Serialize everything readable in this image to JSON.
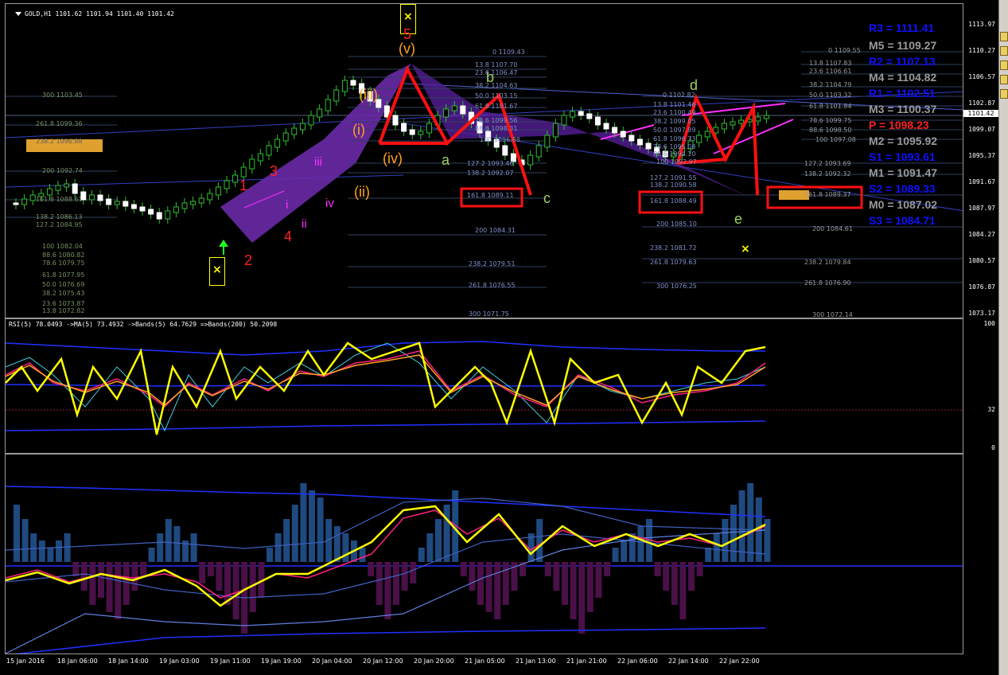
{
  "window": {
    "title": "GOLD,H1  1101.62 1101.94 1101.40 1101.42"
  },
  "price_axis": {
    "labels": [
      "1113.97",
      "1110.27",
      "1106.57",
      "1102.87",
      "1099.07",
      "1095.37",
      "1091.67",
      "1087.97",
      "1084.27",
      "1080.57",
      "1076.87",
      "1073.17"
    ],
    "current": "1101.42"
  },
  "rsi_pane": {
    "title": "RSI(5) 78.0493  ->MA(5) 73.4932  ->Bands(5) 64.7629  =>Bands(200) 50.2098",
    "axis": [
      "100",
      "32",
      "0"
    ]
  },
  "time_axis": {
    "labels": [
      "15 Jan 2016",
      "18 Jan 06:00",
      "18 Jan 14:00",
      "19 Jan 03:00",
      "19 Jan 11:00",
      "19 Jan 19:00",
      "20 Jan 04:00",
      "20 Jan 12:00",
      "20 Jan 20:00",
      "21 Jan 05:00",
      "21 Jan 13:00",
      "21 Jan 21:00",
      "22 Jan 06:00",
      "22 Jan 14:00",
      "22 Jan 22:00"
    ]
  },
  "pivots": [
    {
      "label": "R3 = 1111.41",
      "color": "#1010ff"
    },
    {
      "label": "M5 = 1109.27",
      "color": "#9a9a9a"
    },
    {
      "label": "R2 = 1107.13",
      "color": "#1010ff"
    },
    {
      "label": "M4 = 1104.82",
      "color": "#9a9a9a"
    },
    {
      "label": "R1 = 1102.51",
      "color": "#1010ff"
    },
    {
      "label": "M3 = 1100.37",
      "color": "#9a9a9a"
    },
    {
      "label": "P  = 1098.23",
      "color": "#ff2020"
    },
    {
      "label": "M2 = 1095.92",
      "color": "#9a9a9a"
    },
    {
      "label": "S1 = 1093.61",
      "color": "#1010ff"
    },
    {
      "label": "M1 = 1091.47",
      "color": "#9a9a9a"
    },
    {
      "label": "S2 = 1089.33",
      "color": "#1010ff"
    },
    {
      "label": "M0 = 1087.02",
      "color": "#9a9a9a"
    },
    {
      "label": "S3 = 1084.71",
      "color": "#1010ff"
    }
  ],
  "wave_labels": {
    "w1": "1",
    "w2": "2",
    "w3": "3",
    "w4": "4",
    "w5": "5",
    "ri": "i",
    "rii": "ii",
    "riii": "iii",
    "riv": "iv",
    "pi": "(i)",
    "pii": "(ii)",
    "piii": "(iii)",
    "piv": "(iv)",
    "pv": "(v)",
    "a": "a",
    "b": "b",
    "c": "c",
    "d": "d",
    "e": "e"
  },
  "marks": {
    "x": "×"
  },
  "fib_left": [
    "300 1103.45",
    "261.8 1099.36",
    "238.2 1096.88",
    "200 1092.74",
    "161.8 1088.61",
    "138.2 1086.13",
    "127.2 1084.95",
    "100 1082.04",
    "88.6 1080.82",
    "78.6 1079.75",
    "61.8 1077.95",
    "50.0 1076.69",
    "38.2 1075.43",
    "23.6 1073.87",
    "13.8 1072.82"
  ],
  "fib_mid": [
    "0 1109.43",
    "13.8 1107.70",
    "23.6 1106.47",
    "38.2 1104.63",
    "50.0 1103.15",
    "61.8 1101.67",
    "78.6 1099.56",
    "88.6 1098.31",
    "100 1096.88",
    "127.2 1093.46",
    "138.2 1092.07",
    "161.8 1089.11",
    "200 1084.31",
    "238.2 1079.51",
    "261.8 1076.55",
    "300 1071.75"
  ],
  "fib_mid2": [
    "0 1102.82",
    "13.8 1101.46",
    "23.6 1100.49",
    "38.2 1099.05",
    "50.0 1097.89",
    "61.8 1096.73",
    "78.6 1095.08",
    "88.6 1094.10",
    "100 1092.97",
    "127.2 1091.55",
    "138.2 1090.58",
    "161.8 1088.49",
    "200 1085.10",
    "238.2 1081.72",
    "261.8 1079.63",
    "300 1076.25"
  ],
  "fib_right": [
    "0 1109.55",
    "13.8 1107.83",
    "23.6 1106.61",
    "38.2 1104.79",
    "50.0 1103.32",
    "61.8 1101.84",
    "78.6 1099.75",
    "88.6 1098.50",
    "100 1097.08",
    "127.2 1093.69",
    "138.2 1092.32",
    "161.8 1089.37",
    "200 1084.61",
    "238.2 1079.84",
    "261.8 1076.90",
    "300 1072.14"
  ]
}
